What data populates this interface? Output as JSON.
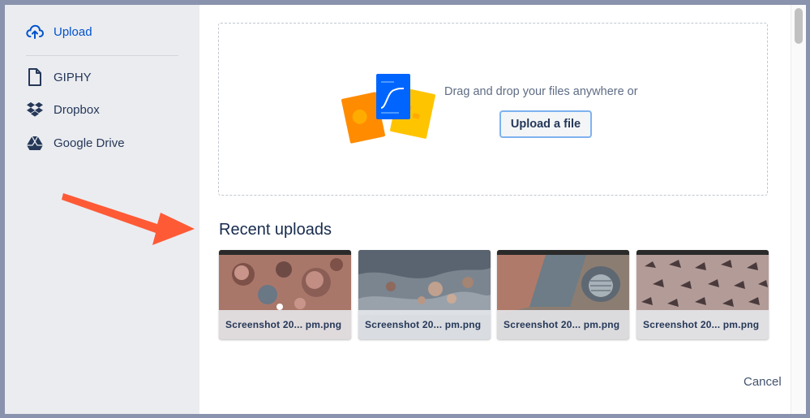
{
  "sidebar": {
    "items": [
      {
        "label": "Upload",
        "icon": "cloud-upload-icon",
        "active": true
      },
      {
        "label": "GIPHY",
        "icon": "document-icon"
      },
      {
        "label": "Dropbox",
        "icon": "dropbox-icon"
      },
      {
        "label": "Google Drive",
        "icon": "google-drive-icon"
      }
    ]
  },
  "dropzone": {
    "text": "Drag and drop your files anywhere or",
    "button_label": "Upload a file"
  },
  "recent": {
    "title": "Recent uploads",
    "items": [
      {
        "label": "Screenshot 20...  pm.png"
      },
      {
        "label": "Screenshot 20...  pm.png"
      },
      {
        "label": "Screenshot 20...  pm.png"
      },
      {
        "label": "Screenshot 20...  pm.png"
      }
    ]
  },
  "footer": {
    "cancel_label": "Cancel"
  },
  "colors": {
    "accent": "#0052cc",
    "annotation_arrow": "#ff5a36",
    "sidebar_bg": "#ebecf0"
  }
}
